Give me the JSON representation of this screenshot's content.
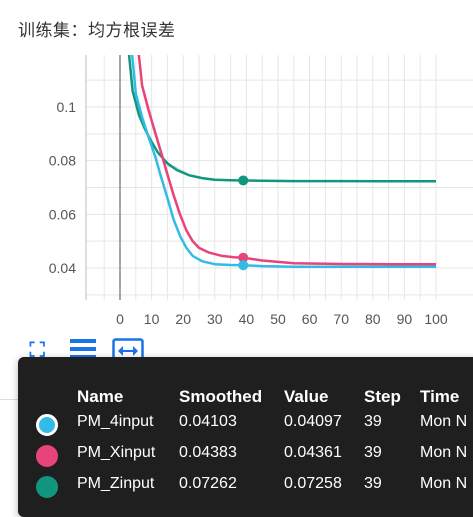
{
  "title": "训练集：均方根误差",
  "chart_data": {
    "type": "line",
    "x_ticks": [
      0,
      10,
      20,
      30,
      40,
      50,
      60,
      70,
      80,
      90,
      100
    ],
    "y_ticks": [
      0.04,
      0.06,
      0.08,
      0.1
    ],
    "y_tick_labels": [
      "0.04",
      "0.06",
      "0.08",
      "0.1"
    ],
    "xlim": [
      -10,
      104
    ],
    "ylim": [
      0.03,
      0.12
    ],
    "grid": true,
    "highlight_step": 39,
    "series": [
      {
        "name": "PM_Zinput",
        "color": "#12967f",
        "x": [
          2,
          4,
          6,
          8,
          10,
          12,
          15,
          18,
          22,
          26,
          30,
          35,
          39,
          45,
          55,
          70,
          85,
          100
        ],
        "y": [
          0.13,
          0.106,
          0.097,
          0.0915,
          0.087,
          0.083,
          0.079,
          0.0765,
          0.0745,
          0.0735,
          0.0729,
          0.0727,
          0.07262,
          0.0725,
          0.0724,
          0.0724,
          0.0723,
          0.0723
        ]
      },
      {
        "name": "PM_Xinput",
        "color": "#e8437b",
        "x": [
          5,
          7,
          9,
          11,
          13,
          15,
          17,
          19,
          21,
          23,
          25,
          28,
          32,
          36,
          39,
          45,
          55,
          70,
          85,
          100
        ],
        "y": [
          0.13,
          0.108,
          0.099,
          0.091,
          0.083,
          0.075,
          0.067,
          0.06,
          0.054,
          0.05,
          0.0475,
          0.0458,
          0.0446,
          0.044,
          0.04383,
          0.0428,
          0.0418,
          0.0415,
          0.0414,
          0.0414
        ]
      },
      {
        "name": "PM_4input",
        "color": "#33bbe8",
        "x": [
          3,
          5,
          7,
          9,
          11,
          13,
          15,
          17,
          19,
          21,
          23,
          26,
          30,
          35,
          39,
          45,
          55,
          70,
          85,
          100
        ],
        "y": [
          0.13,
          0.105,
          0.096,
          0.089,
          0.082,
          0.074,
          0.066,
          0.058,
          0.052,
          0.0475,
          0.0445,
          0.0425,
          0.0414,
          0.0411,
          0.04103,
          0.0407,
          0.0405,
          0.0405,
          0.0405,
          0.0405
        ]
      }
    ]
  },
  "toolbar": {
    "icons": [
      "fit-domain-icon",
      "toggle-log-icon",
      "fullscreen-icon"
    ],
    "color": "#1a73e8"
  },
  "tooltip": {
    "headers": {
      "name": "Name",
      "smoothed": "Smoothed",
      "value": "Value",
      "step": "Step",
      "time": "Time"
    },
    "rows": [
      {
        "name": "PM_4input",
        "smoothed": "0.04103",
        "value": "0.04097",
        "step": "39",
        "time": "Mon N",
        "color": "#33bbe8"
      },
      {
        "name": "PM_Xinput",
        "smoothed": "0.04383",
        "value": "0.04361",
        "step": "39",
        "time": "Mon N",
        "color": "#e8437b"
      },
      {
        "name": "PM_Zinput",
        "smoothed": "0.07262",
        "value": "0.07258",
        "step": "39",
        "time": "Mon N",
        "color": "#12967f"
      }
    ]
  }
}
